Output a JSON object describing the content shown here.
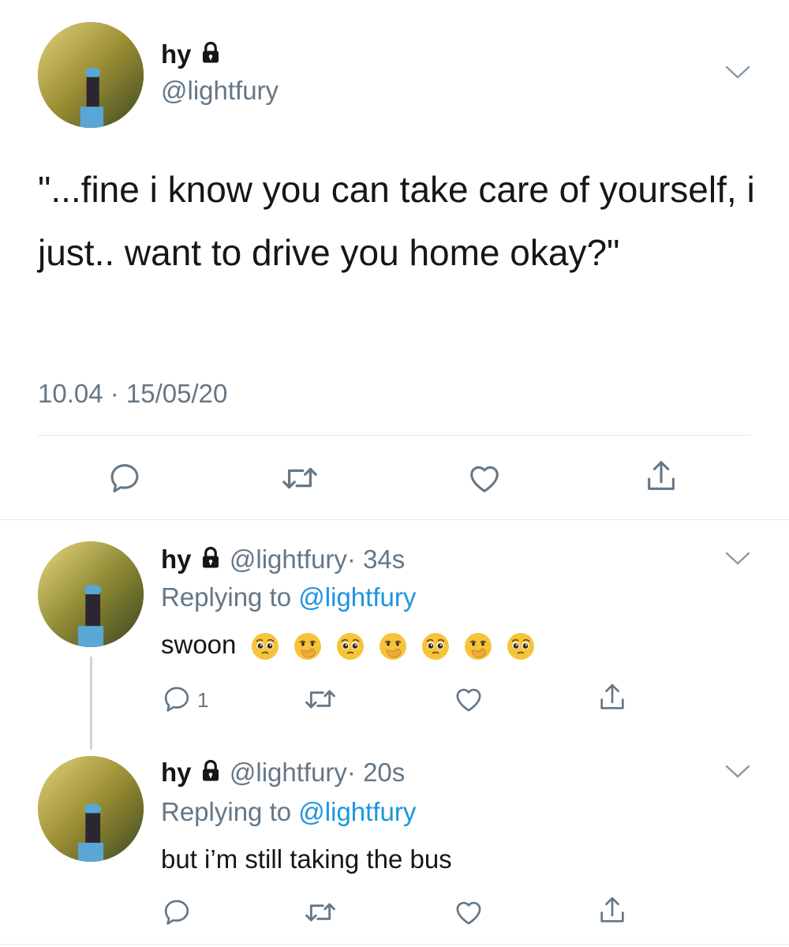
{
  "main_tweet": {
    "name": "hy",
    "handle": "@lightfury",
    "text": "\"...fine i know you can take care of yourself, i just.. want to drive you home okay?\"",
    "timestamp": "10.04 · 15/05/20",
    "lock_icon": "lock-icon",
    "chevron_icon": "chevron-down-icon"
  },
  "replies": [
    {
      "name": "hy",
      "handle": "@lightfury",
      "time": "· 34s",
      "replying_label": "Replying to",
      "replying_handle": "@lightfury",
      "text": "swoon",
      "emojis": [
        "pleading-face",
        "hand-over-mouth",
        "pleading-face",
        "hand-over-mouth",
        "pleading-face",
        "hand-over-mouth",
        "pleading-face"
      ],
      "reply_count": "1"
    },
    {
      "name": "hy",
      "handle": "@lightfury",
      "time": "· 20s",
      "replying_label": "Replying to",
      "replying_handle": "@lightfury",
      "text": "but i’m still taking the bus",
      "reply_count": ""
    }
  ],
  "colors": {
    "text": "#14171a",
    "secondary": "#657786",
    "link": "#1b95e0",
    "divider": "#e1e8ed",
    "icon": "#657786"
  }
}
